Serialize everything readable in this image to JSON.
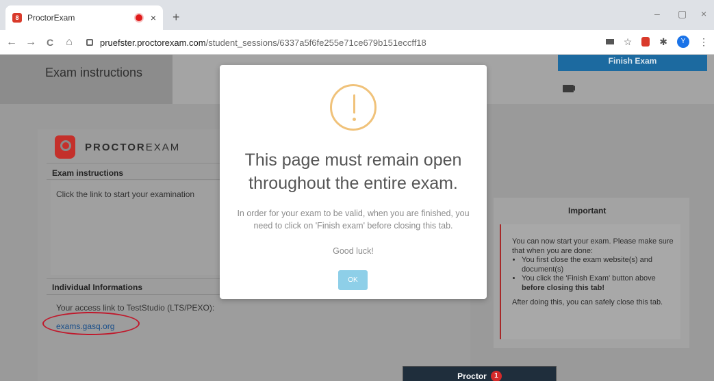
{
  "browser": {
    "tab_title": "ProctorExam",
    "tab_favicon_letter": "8",
    "close_tab": "×",
    "new_tab": "+",
    "url_host": "pruefster.proctorexam.com",
    "url_path": "/student_sessions/6337a5f6fe255e71ce679b151eccff18",
    "avatar_letter": "Y",
    "minimize": "–",
    "restore": "▢",
    "close_window": "×",
    "back": "←",
    "forward": "→",
    "reload": "C",
    "home": "⌂",
    "menu": "⋮",
    "star": "☆",
    "extensions": "✱"
  },
  "page": {
    "header_title": "Exam instructions",
    "finish_button": "Finish Exam",
    "brand_bold": "PROCTOR",
    "brand_light": "EXAM",
    "instructions_heading": "Exam instructions",
    "instructions_text": "Click the link to start your examination",
    "individual_heading": "Individual Informations",
    "access_text": "Your access link to TestStudio (LTS/PEXO):",
    "access_link": "exams.gasq.org",
    "proctor_label": "Proctor",
    "proctor_count": "1"
  },
  "important": {
    "title": "Important",
    "intro": "You can now start your exam. Please make sure that when you are done:",
    "bullet1": "You first close the exam website(s) and document(s)",
    "bullet2_plain": "You click the 'Finish Exam' button above ",
    "bullet2_bold": "before closing this tab!",
    "outro": "After doing this, you can safely close this tab."
  },
  "modal": {
    "title_line1": "This page must remain open",
    "title_line2": "throughout the entire exam.",
    "message": "In order for your exam to be valid, when you are finished, you need to click on 'Finish exam' before closing this tab.",
    "good_luck": "Good luck!",
    "ok_button": "OK"
  },
  "colors": {
    "finish_button": "#1c6aa0",
    "warning": "#f0c27a",
    "ok_button": "#8ecfe8",
    "annotation": "#c0182b"
  }
}
